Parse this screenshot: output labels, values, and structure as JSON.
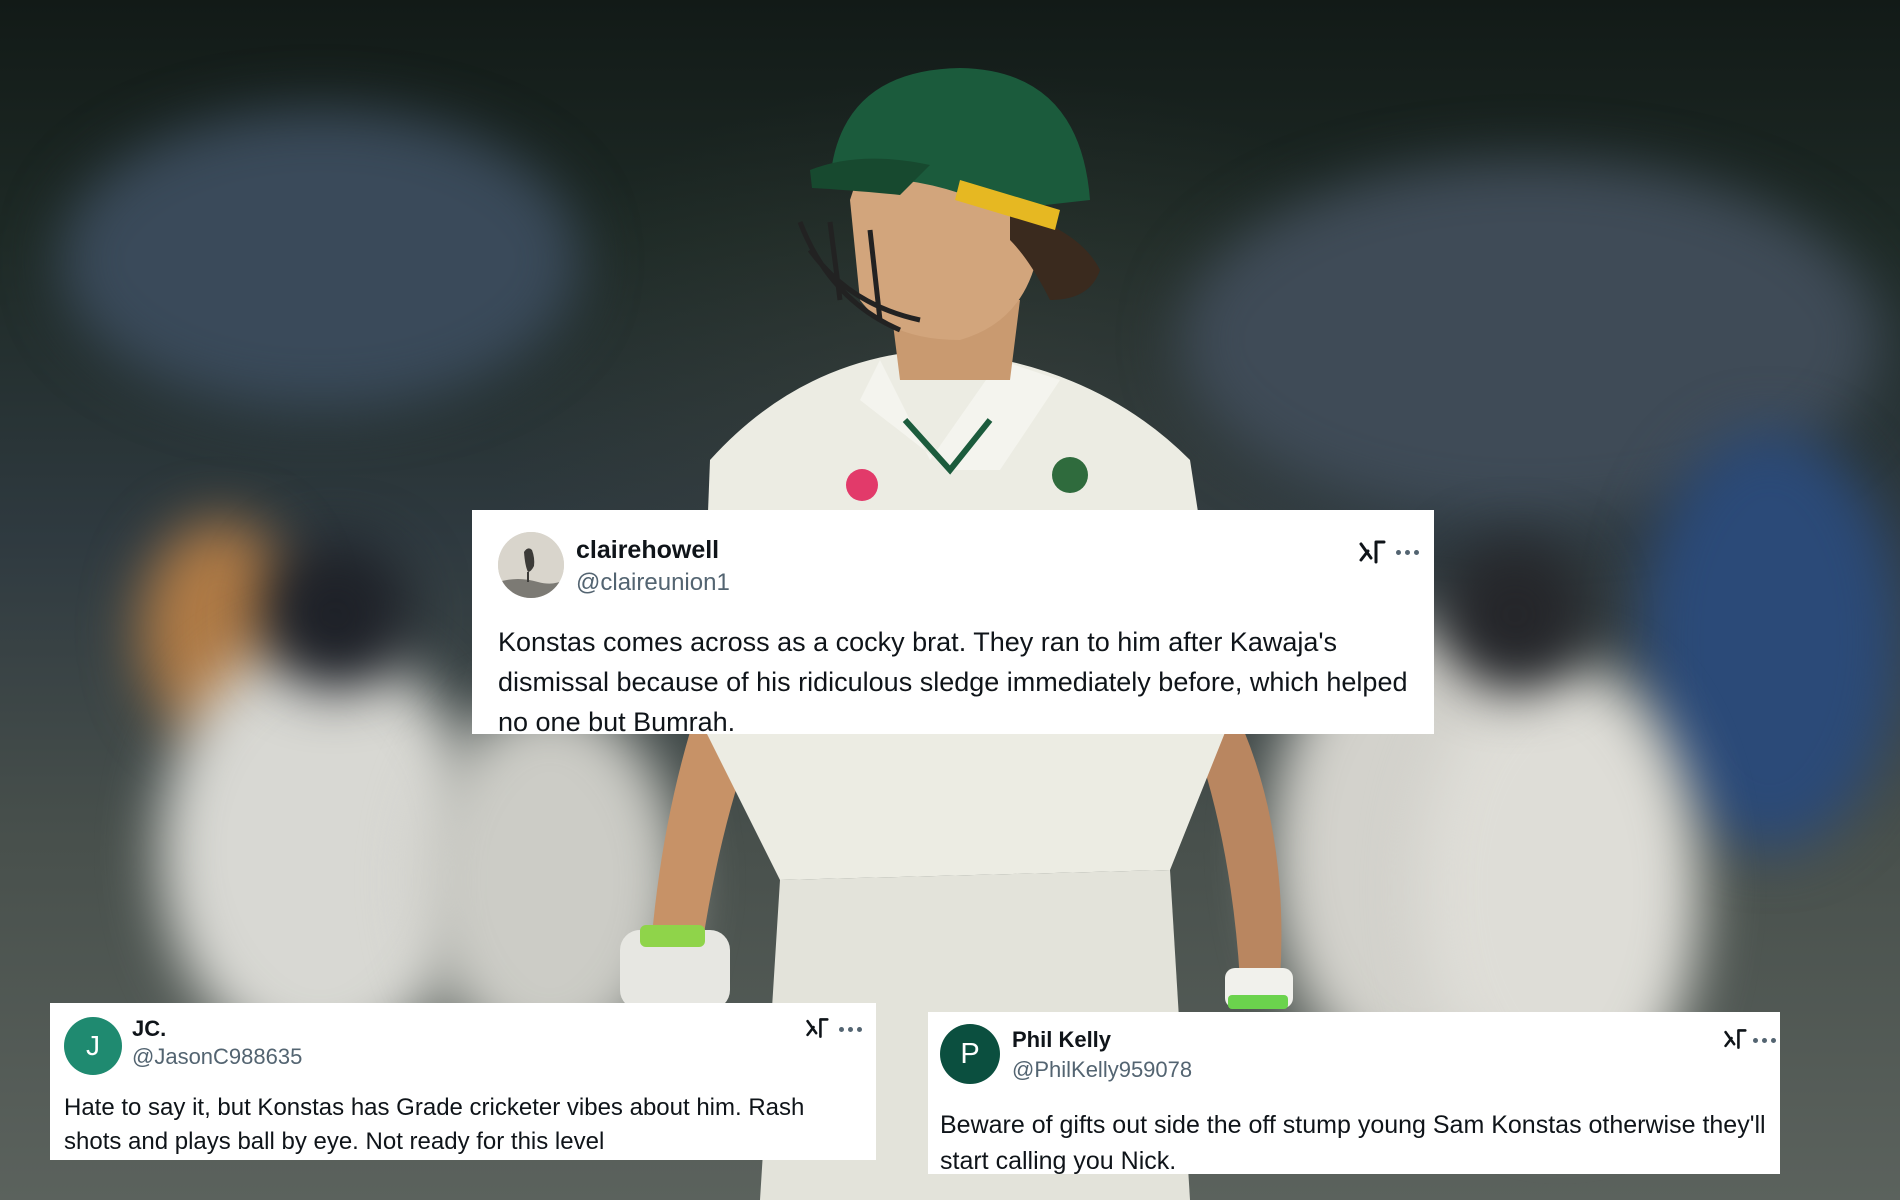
{
  "tweets": [
    {
      "name": "clairehowell",
      "handle": "@claireunion1",
      "text": "Konstas comes across as a cocky brat.  They ran to him after Kawaja's dismissal because of his ridiculous sledge immediately before, which helped no one but Bumrah.",
      "avatar_initial": "",
      "avatar_color": "#d9d5cc"
    },
    {
      "name": "JC.",
      "handle": "@JasonC988635",
      "text": "Hate to say it, but Konstas has Grade cricketer vibes about him. Rash shots and plays ball by eye. Not ready for this level",
      "avatar_initial": "J",
      "avatar_color": "#1f8a70"
    },
    {
      "name": "Phil Kelly",
      "handle": "@PhilKelly959078",
      "text": "Beware of gifts out side the off stump young Sam Konstas otherwise they'll start calling you Nick.",
      "avatar_initial": "P",
      "avatar_color": "#0b4f3f"
    }
  ],
  "icons": {
    "x_logo": "grok-slash-icon",
    "more": "more-horizontal-icon"
  },
  "colors": {
    "helmet": "#1b5b3c",
    "helmet_band": "#e6b822",
    "shirt": "#ecece3",
    "handle_text": "#536471",
    "body_text": "#0f1419"
  }
}
